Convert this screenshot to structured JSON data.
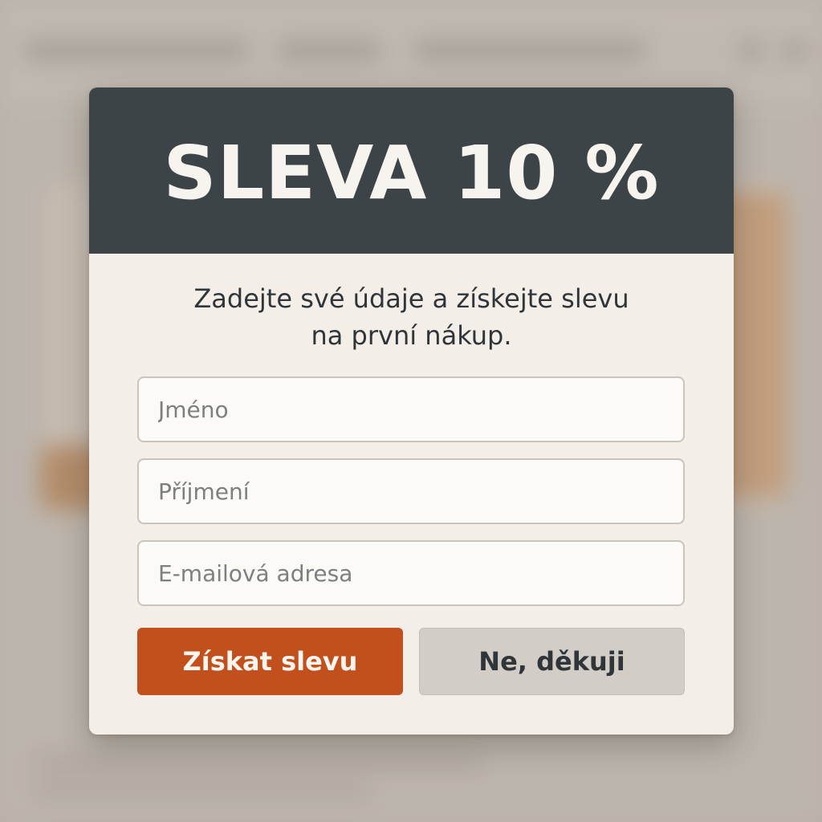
{
  "modal": {
    "title": "SLEVA 10 %",
    "subtitle_line1": "Zadejte své údaje a získejte slevu",
    "subtitle_line2": "na první nákup.",
    "fields": {
      "first_name_placeholder": "Jméno",
      "last_name_placeholder": "Příjmení",
      "email_placeholder": "E-mailová adresa"
    },
    "buttons": {
      "submit_label": "Získat slevu",
      "decline_label": "Ne, děkuji"
    }
  },
  "colors": {
    "header_bg": "#3c4447",
    "modal_bg": "#f3eee7",
    "primary_button": "#c2501d",
    "secondary_button": "#d2cdc6",
    "text_dark": "#2f3538"
  }
}
